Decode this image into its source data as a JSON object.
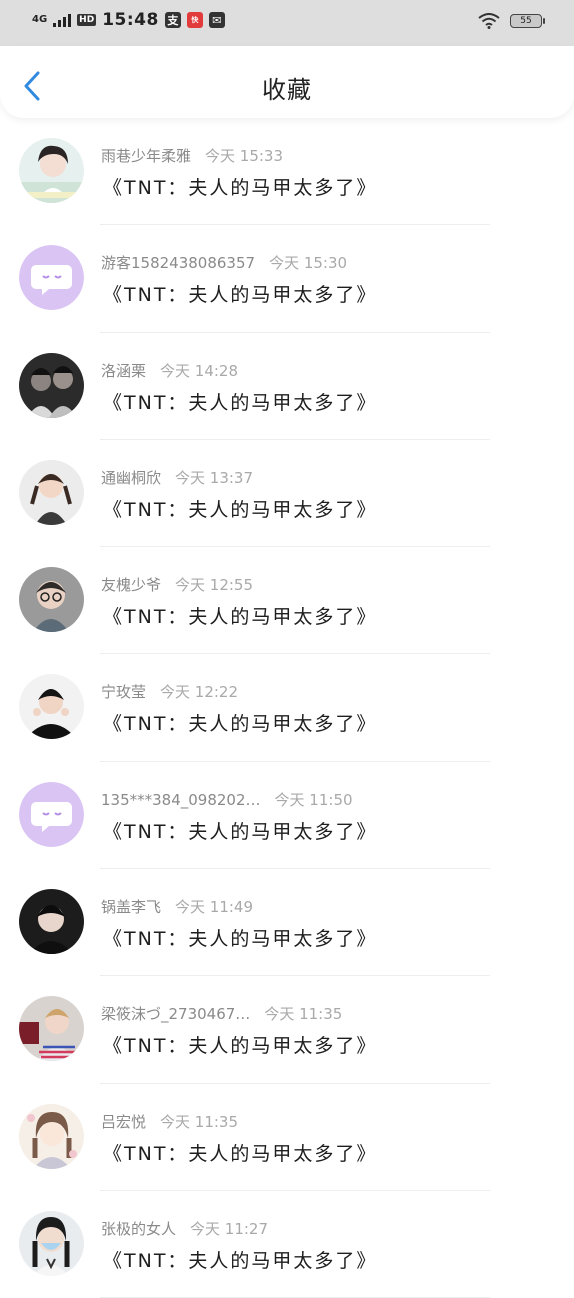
{
  "status_bar": {
    "network": "4G",
    "hd": "HD",
    "time": "15:48",
    "app_icons": [
      "支",
      "快",
      "✉"
    ],
    "battery": "55"
  },
  "header": {
    "title": "收藏",
    "back_icon": "chevron-left-icon"
  },
  "accent_color": "#2f8ae0",
  "items": [
    {
      "name": "雨巷少年柔雅",
      "time": "今天 15:33",
      "content": "《TNT：夫人的马甲太多了》",
      "avatar": "photo-girl-white"
    },
    {
      "name": "游客1582438086357",
      "time": "今天 15:30",
      "content": "《TNT：夫人的马甲太多了》",
      "avatar": "default-chat-avatar"
    },
    {
      "name": "洛涵栗",
      "time": "今天 14:28",
      "content": "《TNT：夫人的马甲太多了》",
      "avatar": "photo-dark-boys"
    },
    {
      "name": "通幽桐欣",
      "time": "今天 13:37",
      "content": "《TNT：夫人的马甲太多了》",
      "avatar": "photo-girl-pigtails"
    },
    {
      "name": "友槐少爷",
      "time": "今天 12:55",
      "content": "《TNT：夫人的马甲太多了》",
      "avatar": "photo-child-glasses"
    },
    {
      "name": "宁玫莹",
      "time": "今天 12:22",
      "content": "《TNT：夫人的马甲太多了》",
      "avatar": "photo-boy-black"
    },
    {
      "name": "135***384_098202…",
      "time": "今天 11:50",
      "content": "《TNT：夫人的马甲太多了》",
      "avatar": "default-chat-avatar"
    },
    {
      "name": "锅盖李飞",
      "time": "今天 11:49",
      "content": "《TNT：夫人的马甲太多了》",
      "avatar": "photo-boy-dark"
    },
    {
      "name": "梁筱沫づ_2730467…",
      "time": "今天 11:35",
      "content": "《TNT：夫人的马甲太多了》",
      "avatar": "photo-boy-striped"
    },
    {
      "name": "吕宏悦",
      "time": "今天 11:35",
      "content": "《TNT：夫人的马甲太多了》",
      "avatar": "illustration-girl"
    },
    {
      "name": "张极的女人",
      "time": "今天 11:27",
      "content": "《TNT：夫人的马甲太多了》",
      "avatar": "photo-girl-mask"
    }
  ]
}
